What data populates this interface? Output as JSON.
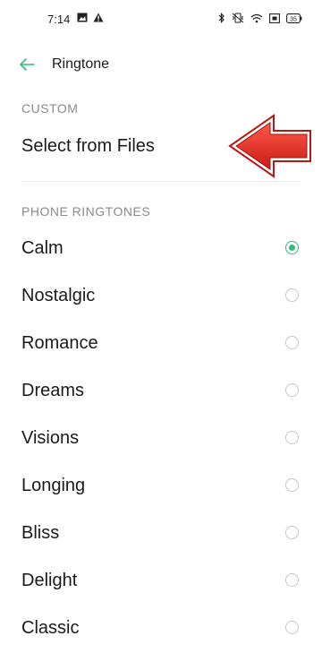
{
  "status_bar": {
    "time": "7:14",
    "left_icons": [
      "gallery-icon",
      "alert-icon"
    ],
    "right_icons": [
      "bluetooth-icon",
      "vibrate-icon",
      "wifi-icon",
      "screen-icon",
      "battery-icon"
    ],
    "battery_level": "35"
  },
  "app_bar": {
    "title": "Ringtone",
    "back_icon": "arrow-left-icon",
    "accent": "#2fbf7a"
  },
  "custom_section": {
    "header": "CUSTOM",
    "select_label": "Select from Files"
  },
  "phone_section": {
    "header": "PHONE RINGTONES",
    "selected": "Calm",
    "items": [
      {
        "label": "Calm"
      },
      {
        "label": "Nostalgic"
      },
      {
        "label": "Romance"
      },
      {
        "label": "Dreams"
      },
      {
        "label": "Visions"
      },
      {
        "label": "Longing"
      },
      {
        "label": "Bliss"
      },
      {
        "label": "Delight"
      },
      {
        "label": "Classic"
      }
    ]
  },
  "colors": {
    "radio_selected": "#2fbf7a",
    "annotation_arrow": "#e8211d"
  }
}
